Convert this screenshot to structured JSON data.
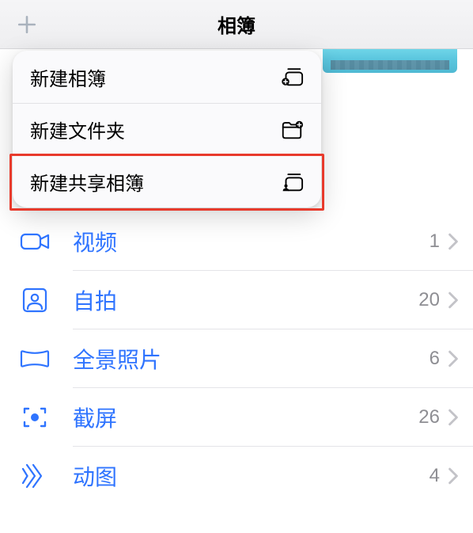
{
  "header": {
    "title": "相簿"
  },
  "popover": {
    "items": [
      {
        "label": "新建相簿"
      },
      {
        "label": "新建文件夹"
      },
      {
        "label": "新建共享相簿"
      }
    ],
    "highlighted_index": 2
  },
  "list": {
    "items": [
      {
        "label": "视频",
        "count": "1",
        "icon": "video"
      },
      {
        "label": "自拍",
        "count": "20",
        "icon": "selfie"
      },
      {
        "label": "全景照片",
        "count": "6",
        "icon": "panorama"
      },
      {
        "label": "截屏",
        "count": "26",
        "icon": "screenshot"
      },
      {
        "label": "动图",
        "count": "4",
        "icon": "animated"
      }
    ]
  }
}
